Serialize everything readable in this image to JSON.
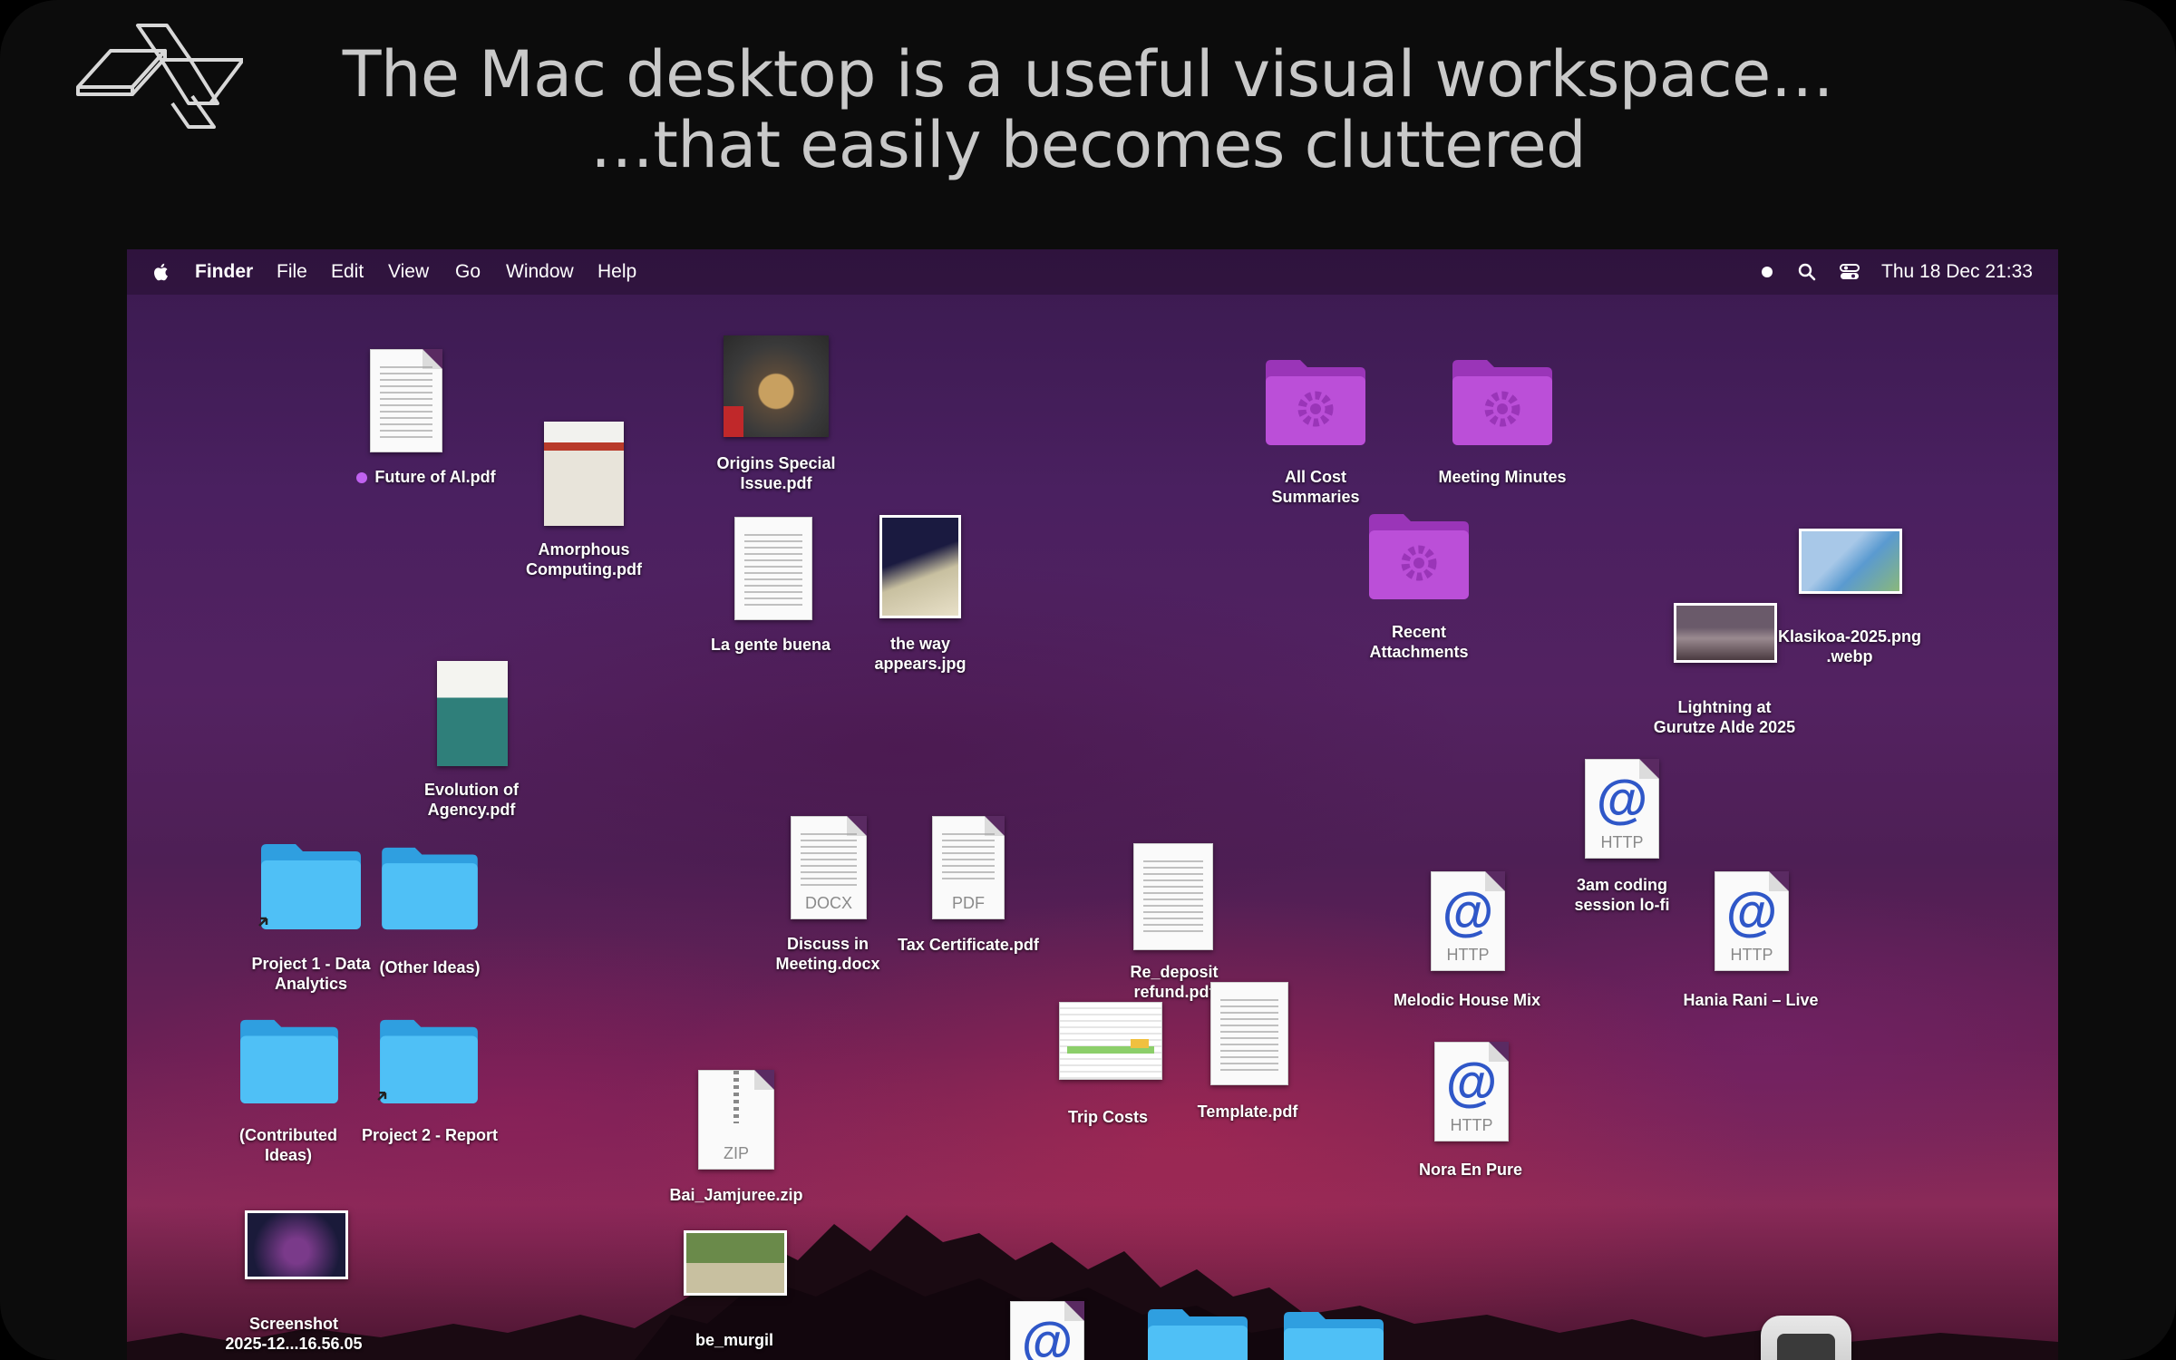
{
  "header": {
    "line1": "The Mac desktop is a useful visual workspace…",
    "line2": "…that easily becomes cluttered"
  },
  "menubar": {
    "app": "Finder",
    "menus": [
      "File",
      "Edit",
      "View",
      "Go",
      "Window",
      "Help"
    ],
    "clock": "Thu 18 Dec  21:33",
    "status_icons": [
      "recording-dot-icon",
      "search-icon",
      "control-center-icon"
    ]
  },
  "icons": {
    "future_ai": "Future of AI.pdf",
    "future_ai_tag_color": "#c062f0",
    "amorphous_1": "Amorphous",
    "amorphous_2": "Computing.pdf",
    "origins_1": "Origins Special",
    "origins_2": "Issue.pdf",
    "la_gente": "La gente buena",
    "the_way_1": "the way",
    "the_way_2": "appears.jpg",
    "evolution_1": "Evolution of",
    "evolution_2": "Agency.pdf",
    "project1_1": "Project 1 - Data",
    "project1_2": "Analytics",
    "other_ideas": "(Other Ideas)",
    "contrib_1": "(Contributed",
    "contrib_2": "Ideas)",
    "project2": "Project 2 - Report",
    "screenshot_1": "Screenshot",
    "screenshot_2": "2025-12...16.56.05",
    "discuss_1": "Discuss in",
    "discuss_2": "Meeting.docx",
    "discuss_ext": "DOCX",
    "tax": "Tax Certificate.pdf",
    "tax_ext": "PDF",
    "re_deposit_1": "Re_deposit",
    "re_deposit_2": "refund.pdf",
    "trip_costs": "Trip Costs",
    "template": "Template.pdf",
    "bai": "Bai_Jamjuree.zip",
    "bai_ext": "ZIP",
    "be_murgil": "be_murgil",
    "all_cost_1": "All Cost",
    "all_cost_2": "Summaries",
    "meeting_minutes": "Meeting Minutes",
    "recent_1": "Recent",
    "recent_2": "Attachments",
    "klasikoa_1": "Klasikoa-2025.png",
    "klasikoa_2": ".webp",
    "lightning_1": "Lightning at",
    "lightning_2": "Gurutze Alde 2025",
    "coding_1": "3am coding",
    "coding_2": "session lo-fi",
    "melodic": "Melodic House Mix",
    "hania": "Hania Rani – Live",
    "nora": "Nora En Pure",
    "http_ext": "HTTP",
    "at_glyph": "@"
  },
  "colors": {
    "folder_blue": "#3eb4f2",
    "folder_purple": "#b94ad6",
    "headline_text": "#c9c9c9"
  }
}
